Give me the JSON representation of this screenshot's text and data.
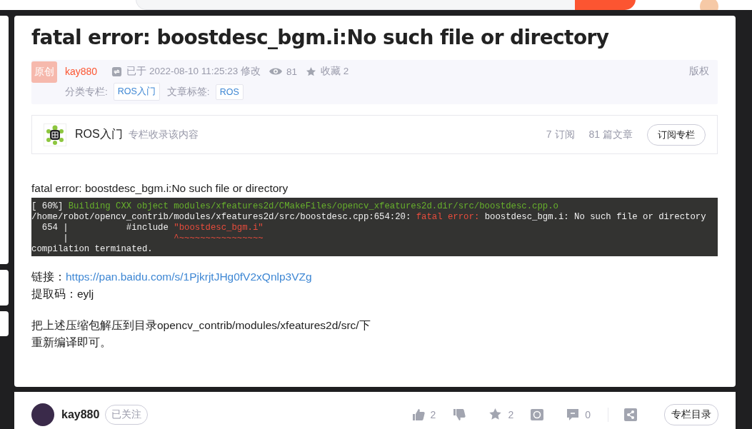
{
  "title": "fatal error: boostdesc_bgm.i:No such file or directory",
  "meta": {
    "badge": "原创",
    "author": "kay880",
    "modified": "已于 2022-08-10 11:25:23 修改",
    "views": "81",
    "favorites": "收藏 2",
    "copyright": "版权",
    "category_label": "分类专栏:",
    "categories": [
      "ROS入门"
    ],
    "tag_label": "文章标签:",
    "tags": [
      "ROS"
    ]
  },
  "column": {
    "name": "ROS入门",
    "note": "专栏收录该内容",
    "subscribers": "7 订阅",
    "articles": "81 篇文章",
    "button": "订阅专栏"
  },
  "body": [
    {
      "kind": "text",
      "text": "fatal error: boostdesc_bgm.i:No such file or directory"
    },
    {
      "kind": "terminal",
      "lines": [
        [
          {
            "text": "[ 60%] "
          },
          {
            "color": "#67b02c",
            "text": "Building CXX object modules/xfeatures2d/CMakeFiles/opencv_xfeatures2d.dir/src/boostdesc.cpp.o"
          }
        ],
        [
          {
            "text": "/home/robot/opencv_contrib/modules/xfeatures2d/src/boostdesc.cpp:654:20: "
          },
          {
            "color": "#e74c3c",
            "text": "fatal error:"
          },
          {
            "text": " boostdesc_bgm.i: No such file or directory"
          }
        ],
        [
          {
            "text": "  654 |           #include "
          },
          {
            "color": "#e74c3c",
            "text": "\"boostdesc_bgm.i\""
          }
        ],
        [
          {
            "text": "      |                    "
          },
          {
            "color": "#e74c3c",
            "text": "^~~~~~~~~~~~~~~~~"
          }
        ],
        [
          {
            "text": "compilation terminated."
          }
        ]
      ]
    },
    {
      "kind": "link",
      "label": "链接：",
      "link": "https://pan.baidu.com/s/1PjkrjtJHg0fV2xQnlp3VZg"
    },
    {
      "kind": "text",
      "text": "提取码：eylj"
    },
    {
      "kind": "gap"
    },
    {
      "kind": "text",
      "text": "把上述压缩包解压到目录opencv_contrib/modules/xfeatures2d/src/下"
    },
    {
      "kind": "text",
      "text": "重新编译即可。"
    }
  ],
  "toolbar": {
    "author": "kay880",
    "follow": "已关注",
    "likes": "2",
    "favorites": "2",
    "comments": "0",
    "catalog": "专栏目录"
  }
}
